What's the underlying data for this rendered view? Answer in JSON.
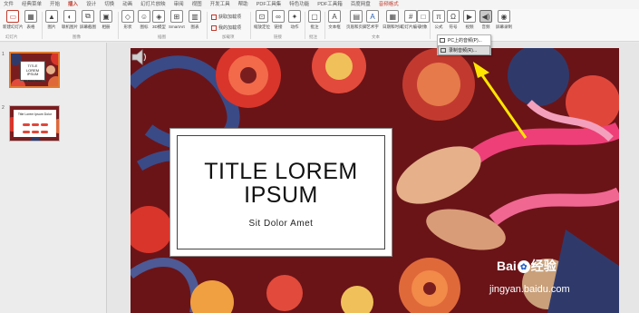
{
  "ribbon": {
    "tabs": [
      "文件",
      "经典菜单",
      "开始",
      "插入",
      "设计",
      "切换",
      "动画",
      "幻灯片放映",
      "审阅",
      "视图",
      "开发工具",
      "帮助",
      "PDF工具集",
      "特色功能",
      "PDF工具箱",
      "百度网盘",
      "音频格式"
    ],
    "active_tab": "插入",
    "buttons": {
      "new_slide": "新建幻灯片",
      "table": "表格",
      "image": "图片",
      "online_image": "联机图片",
      "screenshot": "屏幕截图",
      "album": "相册",
      "shapes": "形状",
      "icons": "图标",
      "model_3d": "3D模型",
      "smartart": "SmartArt",
      "chart": "图表",
      "get_addins": "获取加载项",
      "my_addins": "我的加载项",
      "zoom": "缩放定位",
      "link": "链接",
      "action": "动作",
      "comment": "批注",
      "textbox": "文本框",
      "header_footer": "页眉和页脚",
      "wordart": "艺术字",
      "datetime": "日期和时间",
      "slide_number": "幻灯片编号",
      "object": "对象",
      "equation": "公式",
      "symbol": "符号",
      "video": "视频",
      "audio": "音频",
      "screen_record": "屏幕录制"
    },
    "groups": {
      "slides": "幻灯片",
      "images": "图像",
      "illustrations": "插图",
      "addins": "加载项",
      "links": "链接",
      "comments": "批注",
      "text": "文本",
      "symbols": "符号",
      "media": "媒体"
    }
  },
  "audio_menu": {
    "items": [
      "PC上的音频(P)...",
      "录制音频(R)..."
    ]
  },
  "slides_panel": {
    "numbers": [
      "1",
      "2"
    ],
    "thumb1": {
      "title": "TITLE LOREM IPSUM",
      "sub": "Sit Dolor Amet"
    },
    "thumb2": {
      "title": "Title Lorem Ipsum Dolor"
    }
  },
  "slide": {
    "title": "TITLE LOREM IPSUM",
    "subtitle": "Sit Dolor Amet"
  },
  "watermark": {
    "brand_left": "Bai",
    "brand_right": "经验",
    "url": "jingyan.baidu.com"
  },
  "colors": {
    "accent": "#c0392b",
    "arrow": "#ffe600",
    "slide_background": "#6a1418"
  }
}
